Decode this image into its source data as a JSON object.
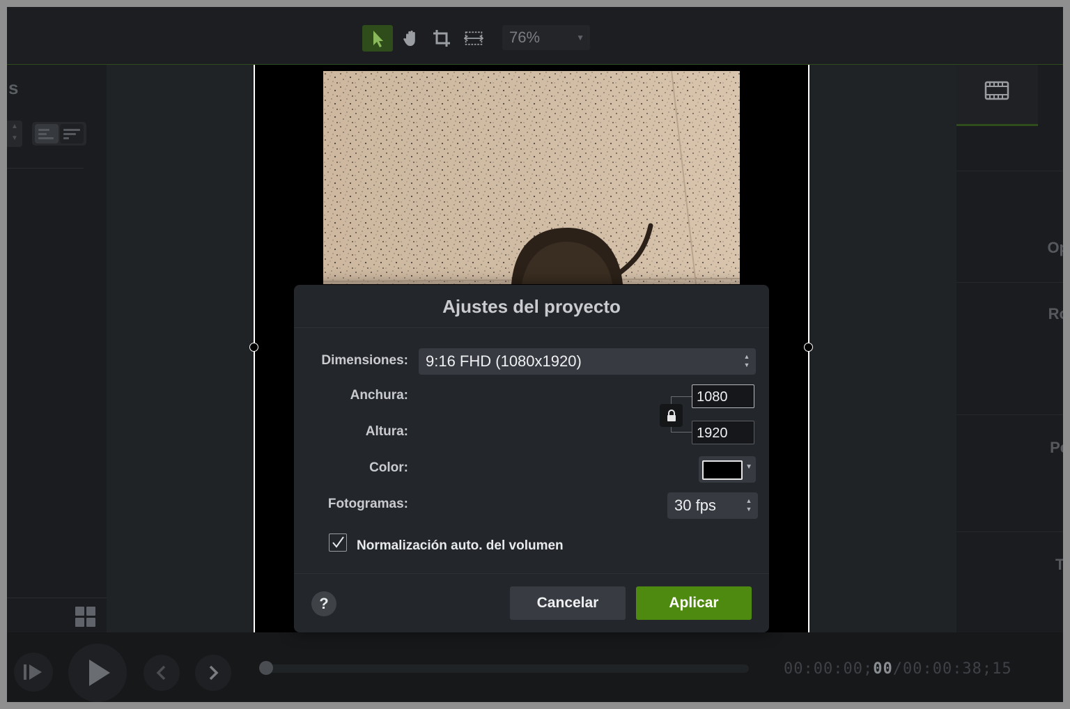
{
  "toolbar": {
    "zoom_value": "76%",
    "tools": [
      "select-tool",
      "pan-tool",
      "crop-tool",
      "fit-tool"
    ]
  },
  "left_panel": {
    "title_fragment": "s"
  },
  "right_panel": {
    "labels": [
      "Op",
      "Ro",
      "Pe",
      "Ti"
    ]
  },
  "dialog": {
    "title": "Ajustes del proyecto",
    "dimensions_label": "Dimensiones:",
    "dimensions_value": "9:16 FHD (1080x1920)",
    "width_label": "Anchura:",
    "width_value": "1080",
    "height_label": "Altura:",
    "height_value": "1920",
    "color_label": "Color:",
    "color_value": "#000000",
    "framerate_label": "Fotogramas:",
    "framerate_value": "30 fps",
    "normalize_label": "Normalización auto. del volumen",
    "normalize_checked": true,
    "help_label": "?",
    "cancel_label": "Cancelar",
    "apply_label": "Aplicar"
  },
  "playback": {
    "timecode_current_dim": "00:00:00;",
    "timecode_current_bright": "00",
    "timecode_total": "/00:00:38;15",
    "progress": 0
  },
  "colors": {
    "accent_green": "#4f8a10",
    "tool_active": "#2e4d1a",
    "canvas_background": "#000000"
  }
}
